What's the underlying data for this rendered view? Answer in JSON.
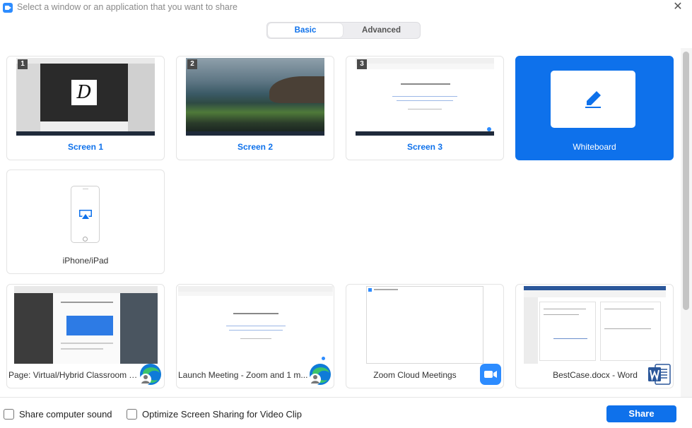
{
  "window": {
    "title": "Select a window or an application that you want to share",
    "close_glyph": "✕"
  },
  "tabs": [
    {
      "label": "Basic",
      "active": true
    },
    {
      "label": "Advanced",
      "active": false
    }
  ],
  "screens": [
    {
      "label": "Screen 1",
      "number": "1"
    },
    {
      "label": "Screen 2",
      "number": "2"
    },
    {
      "label": "Screen 3",
      "number": "3"
    }
  ],
  "whiteboard": {
    "label": "Whiteboard",
    "icon": "pen-icon"
  },
  "iphone": {
    "label": "iPhone/iPad",
    "icon": "airplay-icon"
  },
  "windows": [
    {
      "label": "Page: Virtual/Hybrid Classroom T...",
      "icon": "edge-browser-icon"
    },
    {
      "label": "Launch Meeting - Zoom and 1 m...",
      "icon": "edge-browser-icon"
    },
    {
      "label": "Zoom Cloud Meetings",
      "icon": "zoom-icon"
    },
    {
      "label": "BestCase.docx - Word",
      "icon": "word-icon"
    }
  ],
  "options": {
    "share_sound": "Share computer sound",
    "optimize_video": "Optimize Screen Sharing for Video Clip"
  },
  "share_button": "Share",
  "colors": {
    "accent": "#0e71eb",
    "word": "#2b579a",
    "edge_blue": "#0f7bd8",
    "edge_green": "#3bc36c",
    "zoom": "#2d8cff"
  }
}
